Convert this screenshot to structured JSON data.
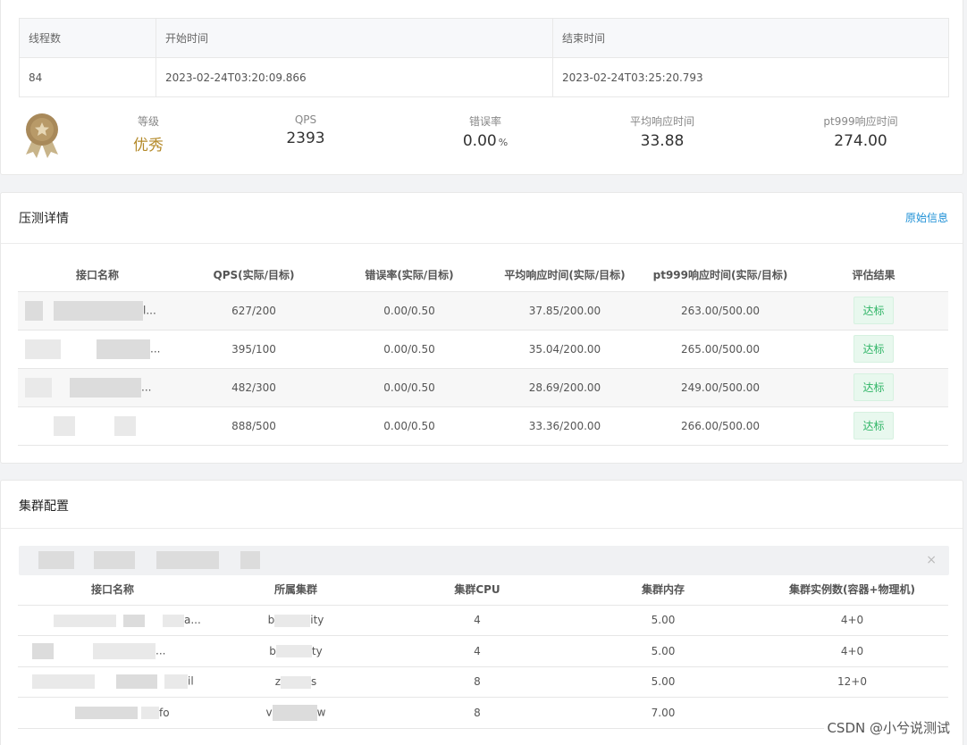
{
  "summary": {
    "headers": [
      "线程数",
      "开始时间",
      "结束时间"
    ],
    "values": [
      "84",
      "2023-02-24T03:20:09.866",
      "2023-02-24T03:25:20.793"
    ],
    "stats": [
      {
        "label": "等级",
        "value": "优秀",
        "unit": ""
      },
      {
        "label": "QPS",
        "value": "2393",
        "unit": ""
      },
      {
        "label": "错误率",
        "value": "0.00",
        "unit": "%"
      },
      {
        "label": "平均响应时间",
        "value": "33.88",
        "unit": ""
      },
      {
        "label": "pt999响应时间",
        "value": "274.00",
        "unit": ""
      }
    ]
  },
  "detail": {
    "title": "压测详情",
    "raw_link": "原始信息",
    "columns": [
      "接口名称",
      "QPS(实际/目标)",
      "错误率(实际/目标)",
      "平均响应时间(实际/目标)",
      "pt999响应时间(实际/目标)",
      "评估结果"
    ],
    "rows": [
      {
        "name_tail": "l...",
        "qps": "627/200",
        "err": "0.00/0.50",
        "avg": "37.85/200.00",
        "pt999": "263.00/500.00",
        "result": "达标"
      },
      {
        "name_tail": "...",
        "qps": "395/100",
        "err": "0.00/0.50",
        "avg": "35.04/200.00",
        "pt999": "265.00/500.00",
        "result": "达标"
      },
      {
        "name_tail": "...",
        "qps": "482/300",
        "err": "0.00/0.50",
        "avg": "28.69/200.00",
        "pt999": "249.00/500.00",
        "result": "达标"
      },
      {
        "name_tail": "",
        "qps": "888/500",
        "err": "0.00/0.50",
        "avg": "33.36/200.00",
        "pt999": "266.00/500.00",
        "result": "达标"
      }
    ]
  },
  "cluster": {
    "title": "集群配置",
    "close_symbol": "×",
    "columns": [
      "接口名称",
      "所属集群",
      "集群CPU",
      "集群内存",
      "集群实例数(容器+物理机)"
    ],
    "rows": [
      {
        "name_tail": "a...",
        "cluster_head": "b",
        "cluster_tail": "ity",
        "cpu": "4",
        "mem": "5.00",
        "inst": "4+0"
      },
      {
        "name_tail": "...",
        "cluster_head": "b",
        "cluster_tail": "ty",
        "cpu": "4",
        "mem": "5.00",
        "inst": "4+0"
      },
      {
        "name_tail": "il",
        "cluster_head": "z",
        "cluster_tail": "s",
        "cpu": "8",
        "mem": "5.00",
        "inst": "12+0"
      },
      {
        "name_tail": "fo",
        "cluster_head": "v",
        "cluster_tail": "w",
        "cpu": "8",
        "mem": "7.00",
        "inst": ""
      }
    ]
  },
  "watermark": "CSDN @小兮说测试"
}
